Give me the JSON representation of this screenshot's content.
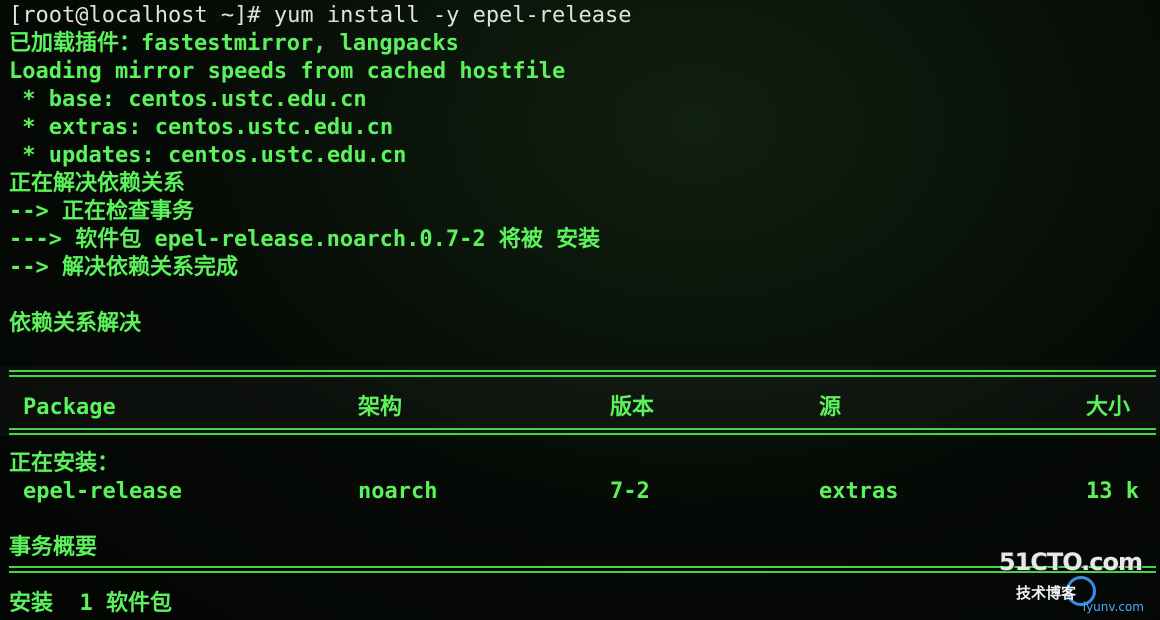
{
  "terminal": {
    "lines": [
      "[root@localhost ~]# yum install -y epel-release",
      "已加载插件：fastestmirror, langpacks",
      "Loading mirror speeds from cached hostfile",
      " * base: centos.ustc.edu.cn",
      " * extras: centos.ustc.edu.cn",
      " * updates: centos.ustc.edu.cn",
      "正在解决依赖关系",
      "--> 正在检查事务",
      "---> 软件包 epel-release.noarch.0.7-2 将被 安装",
      "--> 解决依赖关系完成",
      "依赖关系解决",
      "正在安装：",
      "事务概要",
      "安装  1 软件包"
    ],
    "table": {
      "headers": [
        "Package",
        "架构",
        "版本",
        "源",
        "大小"
      ],
      "row": [
        "epel-release",
        "noarch",
        "7-2",
        "extras",
        "13 k"
      ]
    }
  },
  "watermark": {
    "brand": "51CTO.com",
    "sub": "技术博客",
    "url": "iyunv.com"
  },
  "colors": {
    "text_green": "#5cf25c",
    "prompt": "#d8e8d8",
    "background": "#050805"
  }
}
